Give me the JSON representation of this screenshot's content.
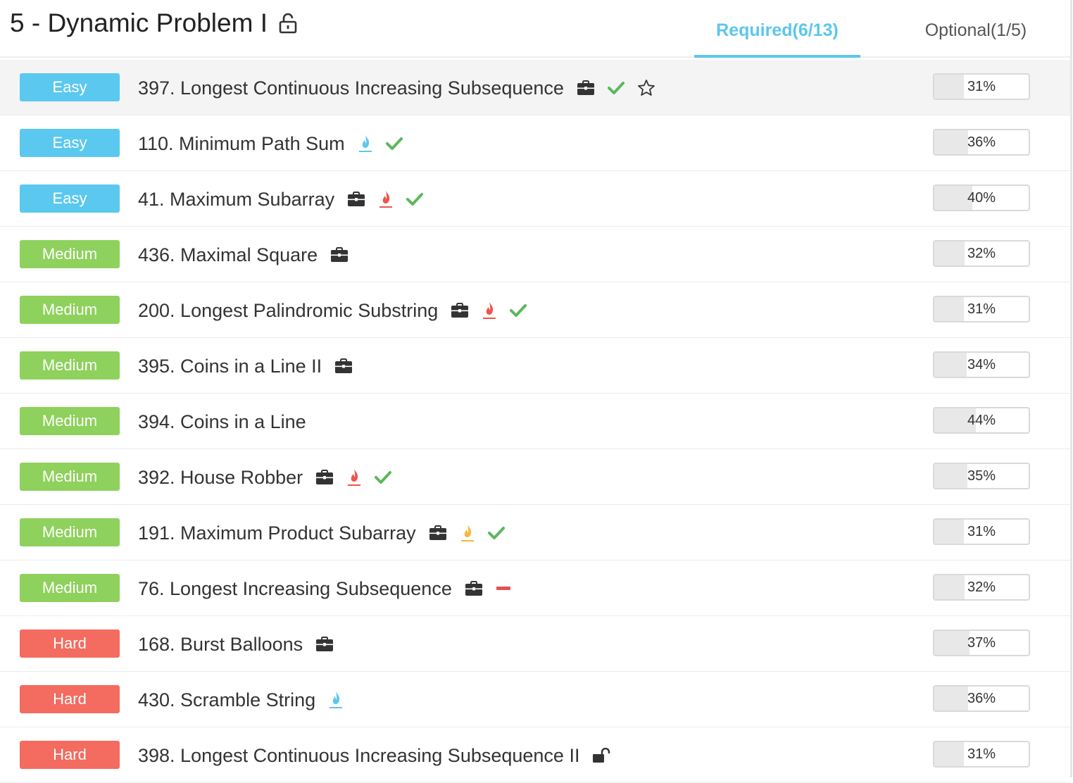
{
  "header": {
    "title": "5 - Dynamic Problem I",
    "tabs": [
      {
        "label": "Required(6/13)",
        "active": true
      },
      {
        "label": "Optional(1/5)",
        "active": false
      }
    ]
  },
  "colors": {
    "accent": "#5cc6ee",
    "easy": "#5bc8ef",
    "medium": "#8ed15c",
    "hard": "#f46b5f",
    "check": "#5cb85c",
    "flame_blue": "#5cc6ee",
    "flame_red": "#f0544a",
    "flame_orange": "#f5b93a",
    "dash": "#e05252",
    "icon_dark": "#333333"
  },
  "problems": [
    {
      "difficulty": "Easy",
      "level": "easy",
      "title": "397. Longest Continuous Increasing Subsequence",
      "icons": [
        "briefcase-icon",
        "check-icon",
        "star-icon"
      ],
      "progress": "31%",
      "progress_value": 0.31,
      "highlight": true
    },
    {
      "difficulty": "Easy",
      "level": "easy",
      "title": "110. Minimum Path Sum",
      "icons": [
        "flame-blue-icon",
        "check-icon"
      ],
      "progress": "36%",
      "progress_value": 0.36,
      "highlight": false
    },
    {
      "difficulty": "Easy",
      "level": "easy",
      "title": "41. Maximum Subarray",
      "icons": [
        "briefcase-icon",
        "flame-red-icon",
        "check-icon"
      ],
      "progress": "40%",
      "progress_value": 0.4,
      "highlight": false
    },
    {
      "difficulty": "Medium",
      "level": "medium",
      "title": "436. Maximal Square",
      "icons": [
        "briefcase-icon"
      ],
      "progress": "32%",
      "progress_value": 0.32,
      "highlight": false
    },
    {
      "difficulty": "Medium",
      "level": "medium",
      "title": "200. Longest Palindromic Substring",
      "icons": [
        "briefcase-icon",
        "flame-red-icon",
        "check-icon"
      ],
      "progress": "31%",
      "progress_value": 0.31,
      "highlight": false
    },
    {
      "difficulty": "Medium",
      "level": "medium",
      "title": "395. Coins in a Line II",
      "icons": [
        "briefcase-icon"
      ],
      "progress": "34%",
      "progress_value": 0.34,
      "highlight": false
    },
    {
      "difficulty": "Medium",
      "level": "medium",
      "title": "394. Coins in a Line",
      "icons": [],
      "progress": "44%",
      "progress_value": 0.44,
      "highlight": false
    },
    {
      "difficulty": "Medium",
      "level": "medium",
      "title": "392. House Robber",
      "icons": [
        "briefcase-icon",
        "flame-red-icon",
        "check-icon"
      ],
      "progress": "35%",
      "progress_value": 0.35,
      "highlight": false
    },
    {
      "difficulty": "Medium",
      "level": "medium",
      "title": "191. Maximum Product Subarray",
      "icons": [
        "briefcase-icon",
        "flame-orange-icon",
        "check-icon"
      ],
      "progress": "31%",
      "progress_value": 0.31,
      "highlight": false
    },
    {
      "difficulty": "Medium",
      "level": "medium",
      "title": "76. Longest Increasing Subsequence",
      "icons": [
        "briefcase-icon",
        "dash-icon"
      ],
      "progress": "32%",
      "progress_value": 0.32,
      "highlight": false
    },
    {
      "difficulty": "Hard",
      "level": "hard",
      "title": "168. Burst Balloons",
      "icons": [
        "briefcase-icon"
      ],
      "progress": "37%",
      "progress_value": 0.37,
      "highlight": false
    },
    {
      "difficulty": "Hard",
      "level": "hard",
      "title": "430. Scramble String",
      "icons": [
        "flame-blue-icon"
      ],
      "progress": "36%",
      "progress_value": 0.36,
      "highlight": false
    },
    {
      "difficulty": "Hard",
      "level": "hard",
      "title": "398. Longest Continuous Increasing Subsequence II",
      "icons": [
        "unlock-icon"
      ],
      "progress": "31%",
      "progress_value": 0.31,
      "highlight": false
    }
  ]
}
